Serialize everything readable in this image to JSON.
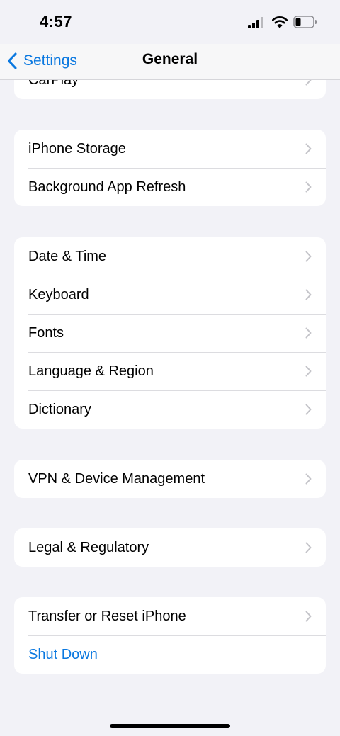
{
  "status_bar": {
    "time": "4:57"
  },
  "nav": {
    "back_label": "Settings",
    "title": "General"
  },
  "groups": [
    {
      "items": [
        {
          "label": "CarPlay",
          "chevron": true
        }
      ]
    },
    {
      "items": [
        {
          "label": "iPhone Storage",
          "chevron": true
        },
        {
          "label": "Background App Refresh",
          "chevron": true
        }
      ]
    },
    {
      "items": [
        {
          "label": "Date & Time",
          "chevron": true
        },
        {
          "label": "Keyboard",
          "chevron": true
        },
        {
          "label": "Fonts",
          "chevron": true
        },
        {
          "label": "Language & Region",
          "chevron": true
        },
        {
          "label": "Dictionary",
          "chevron": true
        }
      ]
    },
    {
      "items": [
        {
          "label": "VPN & Device Management",
          "chevron": true
        }
      ]
    },
    {
      "items": [
        {
          "label": "Legal & Regulatory",
          "chevron": true
        }
      ]
    },
    {
      "items": [
        {
          "label": "Transfer or Reset iPhone",
          "chevron": true
        },
        {
          "label": "Shut Down",
          "chevron": false,
          "color": "#0a78e0"
        }
      ]
    }
  ],
  "colors": {
    "accent": "#0a78e0",
    "background": "#f2f2f7",
    "chevron": "#c4c4c9"
  },
  "icons": {
    "back": "chevron-left-icon",
    "row": "chevron-right-icon",
    "signal": "cellular-signal-icon",
    "wifi": "wifi-icon",
    "battery": "battery-low-icon"
  }
}
